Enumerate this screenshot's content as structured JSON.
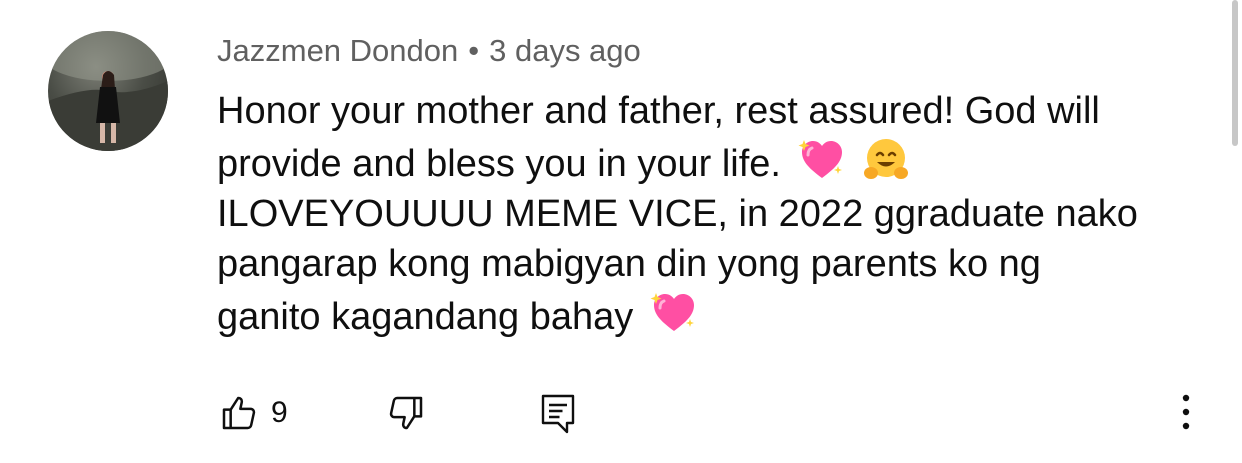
{
  "comment": {
    "author": "Jazzmen Dondon",
    "separator": "•",
    "timestamp": "3 days ago",
    "lines": [
      "Honor your mother and father, rest assured! God will",
      "provide and bless you in your life.",
      "ILOVEYOUUUU MEME VICE, in 2022 ggraduate nako",
      "pangarap kong mabigyan din yong parents ko ng",
      "ganito kagandang bahay"
    ],
    "emojis": [
      "sparkling-heart-icon",
      "hugging-face-icon",
      "sparkling-heart-icon"
    ]
  },
  "actions": {
    "like_count": "9",
    "icons": [
      "thumbs-up-icon",
      "thumbs-down-icon",
      "reply-icon",
      "more-vert-icon"
    ]
  },
  "colors": {
    "text": "#0f0f0f",
    "meta": "#606060",
    "heart": "#ff4fa3",
    "emoji_face": "#ffc83d"
  }
}
